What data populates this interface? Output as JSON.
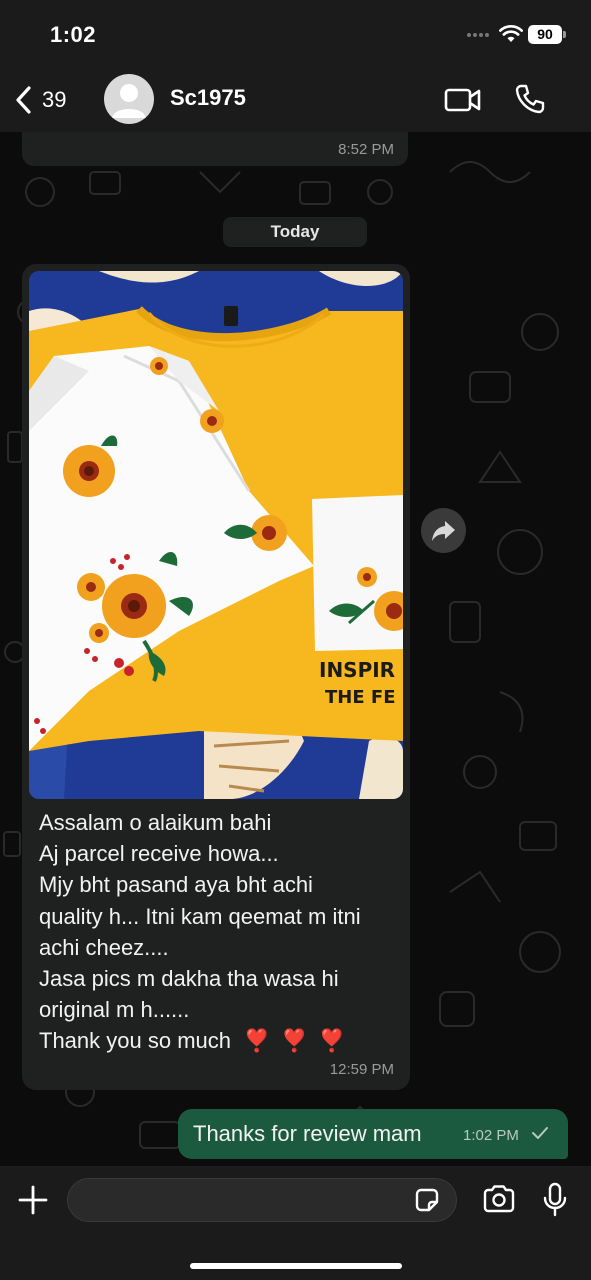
{
  "status_bar": {
    "time": "1:02",
    "battery": "90",
    "icons": [
      "signal-dots-icon",
      "wifi-icon",
      "battery-icon"
    ]
  },
  "header": {
    "unread_count": "39",
    "contact_name": "Sc1975",
    "icons": [
      "back-chevron-icon",
      "avatar-icon",
      "video-call-icon",
      "voice-call-icon"
    ]
  },
  "chat": {
    "previous_message_time": "8:52 PM",
    "date_separator": "Today",
    "incoming": {
      "lines": [
        "Assalam o alaikum bahi",
        "Aj parcel receive howa...",
        "Mjy bht pasand aya bht achi",
        "quality h... Itni kam qeemat m itni",
        "achi cheez....",
        "Jasa pics m dakha tha wasa hi",
        "original m h......",
        "Thank you so much"
      ],
      "emoji": "❣️ ❣️ ❣️",
      "photo_text": [
        "INSPIR",
        "THE FE"
      ],
      "time": "12:59 PM"
    },
    "outgoing": {
      "text": "Thanks for review mam",
      "time": "1:02 PM"
    }
  },
  "input_bar": {
    "icons": [
      "plus-icon",
      "sticker-icon",
      "camera-icon",
      "microphone-icon"
    ]
  },
  "colors": {
    "header_bg": "#1b1b1b",
    "incoming_bubble": "#1f2020",
    "outgoing_bubble": "#1c5a3f",
    "timestamp": "#9a9a9a",
    "emoji_heart": "#e0202a"
  }
}
